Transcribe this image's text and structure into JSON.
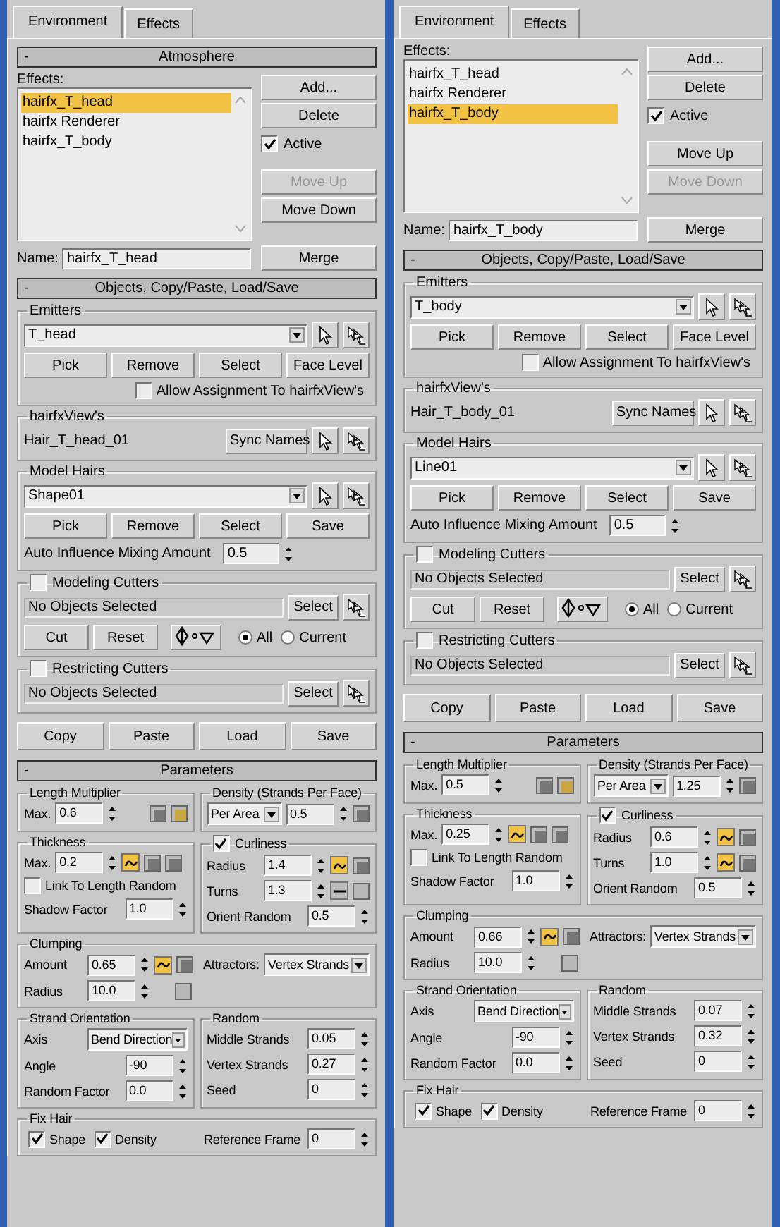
{
  "panels": [
    {
      "tabs": [
        {
          "label": "Environment",
          "selected": true
        },
        {
          "label": "Effects",
          "selected": false
        }
      ],
      "atmosphere": {
        "collapse": "-",
        "title": "Atmosphere"
      },
      "effects": {
        "label": "Effects:",
        "items": [
          {
            "label": "hairfx_T_head",
            "selected": true
          },
          {
            "label": "hairfx Renderer",
            "selected": false
          },
          {
            "label": "hairfx_T_body",
            "selected": false
          }
        ],
        "buttons": [
          {
            "label": "Add...",
            "disabled": false
          },
          {
            "label": "Delete",
            "disabled": false
          }
        ],
        "active": {
          "label": "Active",
          "checked": true
        },
        "move_buttons": [
          {
            "label": "Move Up",
            "disabled": true
          },
          {
            "label": "Move Down",
            "disabled": false
          }
        ],
        "name_label": "Name:",
        "name_value": "hairfx_T_head",
        "merge": "Merge"
      },
      "objects": {
        "collapse": "-",
        "title": "Objects, Copy/Paste, Load/Save",
        "emitters": {
          "title": "Emitters",
          "value": "T_head",
          "buttons": [
            "Pick",
            "Remove",
            "Select",
            "Face Level"
          ],
          "allow": {
            "label": "Allow Assignment To hairfxView's",
            "checked": false
          }
        },
        "hairview": {
          "title": "hairfxView's",
          "value": "Hair_T_head_01",
          "button": "Sync Names"
        },
        "model_hairs": {
          "title": "Model Hairs",
          "value": "Shape01",
          "buttons": [
            "Pick",
            "Remove",
            "Select",
            "Save"
          ],
          "mix_label": "Auto Influence Mixing Amount",
          "mix_value": "0.5"
        },
        "modeling_cutters": {
          "label": "Modeling Cutters",
          "checked": false,
          "status": "No Objects Selected",
          "select": "Select",
          "buttons": [
            "Cut",
            "Reset"
          ],
          "radios": [
            {
              "label": "All",
              "selected": true
            },
            {
              "label": "Current",
              "selected": false
            }
          ]
        },
        "restricting_cutters": {
          "label": "Restricting Cutters",
          "checked": false,
          "status": "No Objects Selected",
          "select": "Select"
        },
        "bottom_buttons": [
          "Copy",
          "Paste",
          "Load",
          "Save"
        ]
      },
      "parameters": {
        "collapse": "-",
        "title": "Parameters",
        "length": {
          "title": "Length Multiplier",
          "max_label": "Max.",
          "max": "0.6"
        },
        "density": {
          "title": "Density (Strands Per Face)",
          "mode": "Per Area",
          "value": "0.5"
        },
        "thickness": {
          "title": "Thickness",
          "max_label": "Max.",
          "max": "0.2",
          "curve_on": true,
          "link": {
            "label": "Link To Length Random",
            "checked": false
          },
          "shadow_label": "Shadow Factor",
          "shadow": "1.0"
        },
        "curliness": {
          "label": "Curliness",
          "checked": true,
          "rows": [
            {
              "label": "Radius",
              "value": "1.4",
              "curve_on": true
            },
            {
              "label": "Turns",
              "value": "1.3",
              "curve_on": false
            }
          ],
          "orient_label": "Orient Random",
          "orient": "0.5"
        },
        "clumping": {
          "title": "Clumping",
          "amount_label": "Amount",
          "amount": "0.65",
          "curve_on": true,
          "radius_label": "Radius",
          "radius": "10.0",
          "attractors_label": "Attractors:",
          "attractors": "Vertex Strands"
        },
        "orientation": {
          "title": "Strand Orientation",
          "axis_label": "Axis",
          "axis": "Bend Direction",
          "rows": [
            {
              "label": "Angle",
              "value": "-90"
            },
            {
              "label": "Random Factor",
              "value": "0.0"
            }
          ]
        },
        "random": {
          "title": "Random",
          "rows": [
            {
              "label": "Middle Strands",
              "value": "0.05"
            },
            {
              "label": "Vertex Strands",
              "value": "0.27"
            },
            {
              "label": "Seed",
              "value": "0"
            }
          ]
        },
        "fix_hair": {
          "title": "Fix Hair",
          "checks": [
            {
              "label": "Shape",
              "checked": true
            },
            {
              "label": "Density",
              "checked": true
            }
          ],
          "ref_label": "Reference Frame",
          "ref": "0"
        }
      }
    },
    {
      "tabs": [
        {
          "label": "Environment",
          "selected": true
        },
        {
          "label": "Effects",
          "selected": false
        }
      ],
      "effects": {
        "label": "Effects:",
        "items": [
          {
            "label": "hairfx_T_head",
            "selected": false
          },
          {
            "label": "hairfx Renderer",
            "selected": false
          },
          {
            "label": "hairfx_T_body",
            "selected": true
          }
        ],
        "buttons": [
          {
            "label": "Add...",
            "disabled": false
          },
          {
            "label": "Delete",
            "disabled": false
          }
        ],
        "active": {
          "label": "Active",
          "checked": true
        },
        "move_buttons": [
          {
            "label": "Move Up",
            "disabled": false
          },
          {
            "label": "Move Down",
            "disabled": true
          }
        ],
        "name_label": "Name:",
        "name_value": "hairfx_T_body",
        "merge": "Merge"
      },
      "objects": {
        "collapse": "-",
        "title": "Objects, Copy/Paste, Load/Save",
        "emitters": {
          "title": "Emitters",
          "value": "T_body",
          "buttons": [
            "Pick",
            "Remove",
            "Select",
            "Face Level"
          ],
          "allow": {
            "label": "Allow Assignment To hairfxView's",
            "checked": false
          }
        },
        "hairview": {
          "title": "hairfxView's",
          "value": "Hair_T_body_01",
          "button": "Sync Names"
        },
        "model_hairs": {
          "title": "Model Hairs",
          "value": "Line01",
          "buttons": [
            "Pick",
            "Remove",
            "Select",
            "Save"
          ],
          "mix_label": "Auto Influence Mixing Amount",
          "mix_value": "0.5"
        },
        "modeling_cutters": {
          "label": "Modeling Cutters",
          "checked": false,
          "status": "No Objects Selected",
          "select": "Select",
          "buttons": [
            "Cut",
            "Reset"
          ],
          "radios": [
            {
              "label": "All",
              "selected": true
            },
            {
              "label": "Current",
              "selected": false
            }
          ]
        },
        "restricting_cutters": {
          "label": "Restricting Cutters",
          "checked": false,
          "status": "No Objects Selected",
          "select": "Select"
        },
        "bottom_buttons": [
          "Copy",
          "Paste",
          "Load",
          "Save"
        ]
      },
      "parameters": {
        "collapse": "-",
        "title": "Parameters",
        "length": {
          "title": "Length Multiplier",
          "max_label": "Max.",
          "max": "0.5"
        },
        "density": {
          "title": "Density (Strands Per Face)",
          "mode": "Per Area",
          "value": "1.25"
        },
        "thickness": {
          "title": "Thickness",
          "max_label": "Max.",
          "max": "0.25",
          "curve_on": true,
          "link": {
            "label": "Link To Length Random",
            "checked": false
          },
          "shadow_label": "Shadow Factor",
          "shadow": "1.0"
        },
        "curliness": {
          "label": "Curliness",
          "checked": true,
          "rows": [
            {
              "label": "Radius",
              "value": "0.6",
              "curve_on": true
            },
            {
              "label": "Turns",
              "value": "1.0",
              "curve_on": true
            }
          ],
          "orient_label": "Orient Random",
          "orient": "0.5"
        },
        "clumping": {
          "title": "Clumping",
          "amount_label": "Amount",
          "amount": "0.66",
          "curve_on": true,
          "radius_label": "Radius",
          "radius": "10.0",
          "attractors_label": "Attractors:",
          "attractors": "Vertex Strands"
        },
        "orientation": {
          "title": "Strand Orientation",
          "axis_label": "Axis",
          "axis": "Bend Direction",
          "rows": [
            {
              "label": "Angle",
              "value": "-90"
            },
            {
              "label": "Random Factor",
              "value": "0.0"
            }
          ]
        },
        "random": {
          "title": "Random",
          "rows": [
            {
              "label": "Middle Strands",
              "value": "0.07"
            },
            {
              "label": "Vertex Strands",
              "value": "0.32"
            },
            {
              "label": "Seed",
              "value": "0"
            }
          ]
        },
        "fix_hair": {
          "title": "Fix Hair",
          "checks": [
            {
              "label": "Shape",
              "checked": true
            },
            {
              "label": "Density",
              "checked": true
            }
          ],
          "ref_label": "Reference Frame",
          "ref": "0"
        }
      }
    }
  ]
}
